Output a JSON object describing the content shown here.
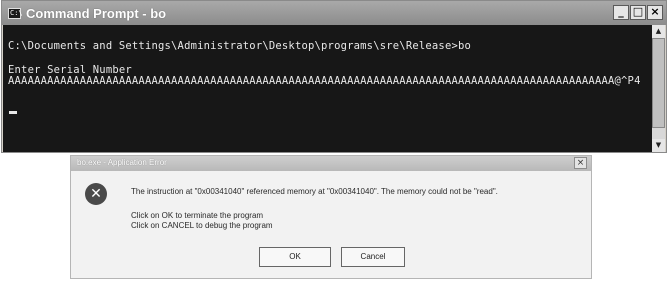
{
  "console": {
    "icon_text": "C:\\",
    "title": "Command Prompt - bo",
    "controls": {
      "minimize": "_",
      "restore": "□",
      "close": "×"
    },
    "lines": [
      "C:\\Documents and Settings\\Administrator\\Desktop\\programs\\sre\\Release>bo",
      "Enter Serial Number",
      "AAAAAAAAAAAAAAAAAAAAAAAAAAAAAAAAAAAAAAAAAAAAAAAAAAAAAAAAAAAAAAAAAAAAAAAAAAAAAAAAAAAAAAAAAAAAA@^P4"
    ],
    "scrollbar": {
      "up": "▲",
      "down": "▼"
    }
  },
  "dialog": {
    "title": "bo.exe - Application Error",
    "close": "×",
    "icon": "error-icon",
    "icon_glyph": "✕",
    "message": "The instruction at \"0x00341040\" referenced memory at \"0x00341040\". The memory could not be \"read\".",
    "hint_ok": "Click on OK to terminate the program",
    "hint_cancel": "Click on CANCEL to debug the program",
    "ok_label": "OK",
    "cancel_label": "Cancel"
  }
}
